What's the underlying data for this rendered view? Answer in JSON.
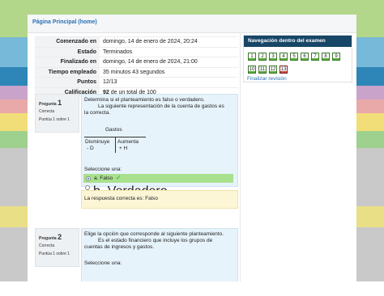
{
  "colors": {
    "stripes": [
      "#b3d78a",
      "#77b9d8",
      "#2e86b8",
      "#c9a3c9",
      "#eaa9a9",
      "#f1de78",
      "#9ed08e",
      "#c9c9c9",
      "#c9c9c9",
      "#e9df86"
    ],
    "nav_header": "#174666",
    "link": "#2a6fb3",
    "correct_option_bg": "#a9e08e",
    "feedback_bg": "#fcf6d6",
    "question_bg": "#e7f3fb"
  },
  "nav": {
    "home_link": "Página Principal (home)"
  },
  "summary": [
    {
      "label": "Comenzado en",
      "value": "domingo, 14 de enero de 2024, 20:24"
    },
    {
      "label": "Estado",
      "value": "Terminados"
    },
    {
      "label": "Finalizado en",
      "value": "domingo, 14 de enero de 2024, 21:00"
    },
    {
      "label": "Tiempo empleado",
      "value": "35 minutos 43 segundos"
    },
    {
      "label": "Puntos",
      "value": "12/13"
    },
    {
      "label": "Calificación",
      "value_bold": "92",
      "value_rest": " de un total de 100"
    }
  ],
  "questions": [
    {
      "prefix": "Pregunta",
      "number": "1",
      "status": "Correcta",
      "score": "Puntúa 1 sobre 1",
      "text_line1": "Determina si el planteamiento es falso o verdadero.",
      "text_line2": "La siguiente representación de la cuenta de gastos es",
      "text_line3": "la correcta.",
      "t_account": {
        "title": "Gastos",
        "left_line1": "Disminuye",
        "left_line2": "- D",
        "right_line1": "Aumenta",
        "right_line2": "+ H"
      },
      "prompt": "Seleccione una:",
      "options": [
        {
          "label": "a. Falso",
          "selected": true,
          "correct": true
        },
        {
          "label": "b. Verdadero",
          "selected": false,
          "correct": false
        }
      ],
      "feedback": "La respuesta correcta es: Falso"
    },
    {
      "prefix": "Pregunta",
      "number": "2",
      "status": "Correcta",
      "score": "Puntúa 1 sobre 1",
      "text_line1": "Elige la opción que corresponde al siguiente planteamiento.",
      "text_line2": "Es el estado financiero que incluye los grupos de",
      "text_line3": "cuentas de ingresos y gastos.",
      "prompt": "Seleccione una:"
    }
  ],
  "quiz_nav": {
    "title": "Navegación dentro del examen",
    "buttons": [
      {
        "label": "1",
        "state": "correct"
      },
      {
        "label": "2",
        "state": "correct"
      },
      {
        "label": "3",
        "state": "correct"
      },
      {
        "label": "4",
        "state": "correct"
      },
      {
        "label": "5",
        "state": "correct"
      },
      {
        "label": "6",
        "state": "correct"
      },
      {
        "label": "7",
        "state": "correct"
      },
      {
        "label": "8",
        "state": "correct"
      },
      {
        "label": "9",
        "state": "correct"
      },
      {
        "label": "10",
        "state": "correct"
      },
      {
        "label": "11",
        "state": "correct"
      },
      {
        "label": "12",
        "state": "correct"
      },
      {
        "label": "13",
        "state": "incorrect"
      }
    ],
    "finish_link": "Finalizar revisión"
  }
}
